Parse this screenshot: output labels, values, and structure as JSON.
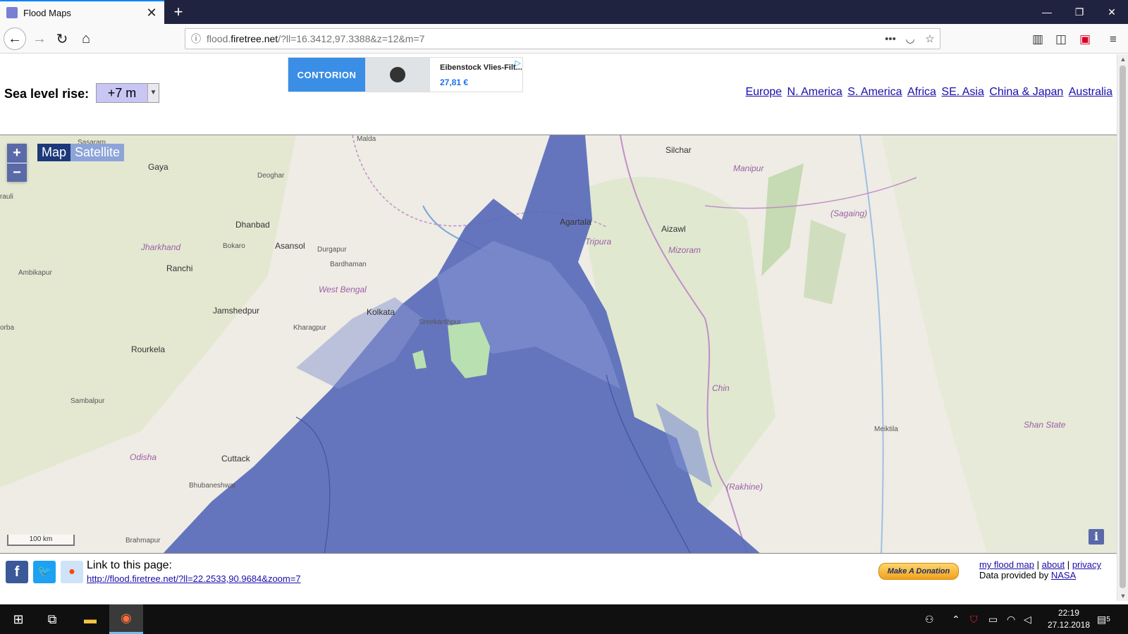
{
  "browser": {
    "tab_title": "Flood Maps",
    "tab_close": "✕",
    "new_tab": "+",
    "url_prefix": "flood.",
    "url_domain": "firetree.net",
    "url_path": "/?ll=16.3412,97.3388&z=12&m=7",
    "window_controls": [
      "—",
      "❐",
      "✕"
    ]
  },
  "page": {
    "sea_level_label": "Sea level rise:",
    "sea_level_value": "+7 m",
    "regions": [
      "Europe",
      "N. America",
      "S. America",
      "Africa",
      "SE. Asia",
      "China & Japan",
      "Australia"
    ],
    "ad": {
      "brand": "CONTORION",
      "product": "Eibenstock Vlies-Filt...",
      "price": "27,81 €"
    }
  },
  "map": {
    "zoom_in": "+",
    "zoom_out": "−",
    "type_map": "Map",
    "type_satellite": "Satellite",
    "scale": "100 km",
    "info": "i",
    "flood_color": "#5568b8",
    "labels": [
      {
        "text": "Gaya",
        "cls": ""
      },
      {
        "text": "Deoghar",
        "cls": "sm"
      },
      {
        "text": "Dhanbad",
        "cls": ""
      },
      {
        "text": "Bokaro",
        "cls": "sm"
      },
      {
        "text": "Asansol",
        "cls": ""
      },
      {
        "text": "Durgapur",
        "cls": "sm"
      },
      {
        "text": "Jharkhand",
        "cls": "ital"
      },
      {
        "text": "Ranchi",
        "cls": ""
      },
      {
        "text": "Ambikapur",
        "cls": "sm"
      },
      {
        "text": "Bardhaman",
        "cls": "sm"
      },
      {
        "text": "West Bengal",
        "cls": "ital"
      },
      {
        "text": "Jamshedpur",
        "cls": ""
      },
      {
        "text": "Kharagpur",
        "cls": "sm"
      },
      {
        "text": "Kolkata",
        "cls": ""
      },
      {
        "text": "Rourkela",
        "cls": ""
      },
      {
        "text": "Sambalpur",
        "cls": "sm"
      },
      {
        "text": "Odisha",
        "cls": "ital"
      },
      {
        "text": "Cuttack",
        "cls": ""
      },
      {
        "text": "Bhubaneshwar",
        "cls": "sm"
      },
      {
        "text": "Brahmapur",
        "cls": "sm"
      },
      {
        "text": "Malda",
        "cls": "sm"
      },
      {
        "text": "Silchar",
        "cls": ""
      },
      {
        "text": "Manipur",
        "cls": "ital"
      },
      {
        "text": "Agartala",
        "cls": ""
      },
      {
        "text": "Aizawl",
        "cls": ""
      },
      {
        "text": "Tripura",
        "cls": "ital"
      },
      {
        "text": "Mizoram",
        "cls": "ital"
      },
      {
        "text": "(Sagaing)",
        "cls": "ital"
      },
      {
        "text": "Chin",
        "cls": "ital"
      },
      {
        "text": "Meiktila",
        "cls": "sm"
      },
      {
        "text": "Shan State",
        "cls": "ital"
      },
      {
        "text": "(Rakhine)",
        "cls": "ital"
      },
      {
        "text": "Sreekanthpur",
        "cls": "sm"
      },
      {
        "text": "Sasaram",
        "cls": "sm"
      },
      {
        "text": "rauli",
        "cls": "sm"
      },
      {
        "text": "orba",
        "cls": "sm"
      }
    ]
  },
  "footer": {
    "link_label": "Link to this page:",
    "link_url": "http://flood.firetree.net/?ll=22.2533,90.9684&zoom=7",
    "donate": "Make A Donation",
    "my_flood_map": "my flood map",
    "about": "about",
    "privacy": "privacy",
    "sep": "|",
    "data_provided": "Data provided by",
    "nasa": "NASA"
  },
  "taskbar": {
    "time": "22:19",
    "date": "27.12.2018",
    "notifications": "5"
  }
}
